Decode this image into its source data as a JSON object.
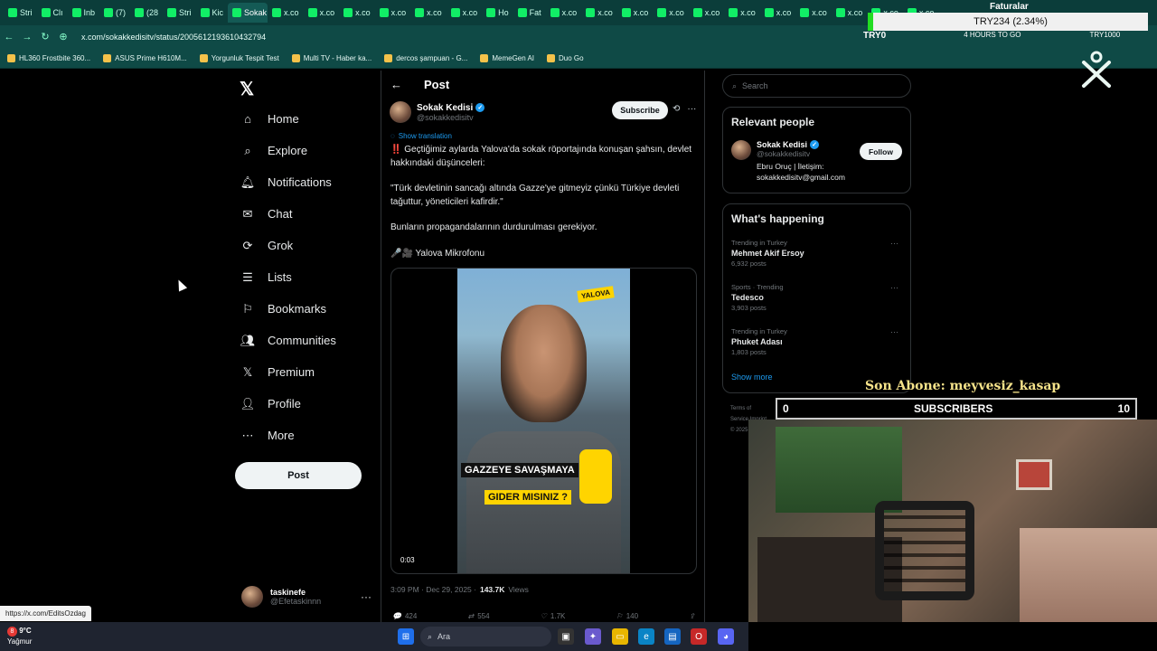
{
  "browser": {
    "tabs": [
      "Stri",
      "Clı",
      "Inb",
      "(7)",
      "(28",
      "Stri",
      "Kic",
      "Sokak",
      "x.co",
      "x.co",
      "x.co",
      "x.co",
      "x.co",
      "x.co",
      "Ho",
      "Fat",
      "x.co",
      "x.co",
      "x.co",
      "x.co",
      "x.co",
      "x.co",
      "x.co",
      "x.co",
      "x.co",
      "x.co",
      "x.co"
    ],
    "url": "x.com/sokakkedisitv/status/2005612193610432794",
    "bookmarks": [
      "HL360 Frostbite 360...",
      "ASUS Prime H610M...",
      "Yorgunluk Tespit Test",
      "Multi TV - Haber ka...",
      "dercos şampuan - G...",
      "MemeGen AI",
      "Duo Go"
    ]
  },
  "overlay": {
    "faturalar": "Faturalar",
    "price": "TRY234 (2.34%)",
    "tryo": "TRY0",
    "timer": "4 HOURS TO GO",
    "try_right": "TRY1000",
    "son_abone": "Son Abone: meyvesiz_kasap",
    "subs_left": "0",
    "subs_label": "SUBSCRIBERS",
    "subs_right": "10"
  },
  "nav": {
    "items": [
      {
        "label": "Home",
        "icon": "home-icon"
      },
      {
        "label": "Explore",
        "icon": "search-icon"
      },
      {
        "label": "Notifications",
        "icon": "bell-icon"
      },
      {
        "label": "Chat",
        "icon": "mail-icon"
      },
      {
        "label": "Grok",
        "icon": "grok-icon"
      },
      {
        "label": "Lists",
        "icon": "list-icon"
      },
      {
        "label": "Bookmarks",
        "icon": "bookmark-icon"
      },
      {
        "label": "Communities",
        "icon": "people-icon"
      },
      {
        "label": "Premium",
        "icon": "x-icon"
      },
      {
        "label": "Profile",
        "icon": "person-icon"
      },
      {
        "label": "More",
        "icon": "more-icon"
      }
    ],
    "post_label": "Post",
    "account_name": "taskinefe",
    "account_handle": "@Efetaskinnn"
  },
  "post": {
    "header": "Post",
    "author_name": "Sokak Kedisi",
    "author_handle": "@sokakkedisitv",
    "subscribe_label": "Subscribe",
    "translate_label": "Show translation",
    "text1": "‼️ Geçtiğimiz aylarda Yalova'da sokak röportajında konuşan şahsın, devlet hakkındaki düşünceleri:",
    "text2": "\"Türk devletinin sancağı altında Gazze'ye gitmeyiz çünkü Türkiye devleti tağuttur, yöneticileri kafirdir.\"",
    "text3": "Bunların propagandalarının durdurulması gerekiyor.",
    "text4": "🎤🎥 Yalova Mikrofonu",
    "video_duration": "0:03",
    "video_badge": "YALOVA",
    "video_caption1": "GAZZEYE SAVAŞMAYA",
    "video_caption2": "GIDER MISINIZ ?",
    "time": "3:09 PM · Dec 29, 2025 · ",
    "views_count": "143.7K",
    "views_label": "Views",
    "replies": "424",
    "reposts": "554",
    "likes": "1.7K",
    "bookmarks": "140"
  },
  "sidebar": {
    "search_placeholder": "Search",
    "relevant_title": "Relevant people",
    "person_name": "Sokak Kedisi",
    "person_handle": "@sokakkedisitv",
    "person_bio": "Ebru Oruç | İletişim: sokakkedisitv@gmail.com",
    "follow_label": "Follow",
    "happening_title": "What's happening",
    "trends": [
      {
        "context": "Trending in Turkey",
        "title": "Mehmet Akif Ersoy",
        "count": "6,932 posts"
      },
      {
        "context": "Sports · Trending",
        "title": "Tedesco",
        "count": "3,903 posts"
      },
      {
        "context": "Trending in Turkey",
        "title": "Phuket Adası",
        "count": "1,803 posts"
      }
    ],
    "show_more": "Show more",
    "footer": "Terms of Service Imprint © 2025"
  },
  "status_url": "https://x.com/EditsOzdag",
  "taskbar": {
    "badge": "8",
    "temp": "9°C",
    "weather": "Yağmur",
    "search_placeholder": "Ara"
  }
}
